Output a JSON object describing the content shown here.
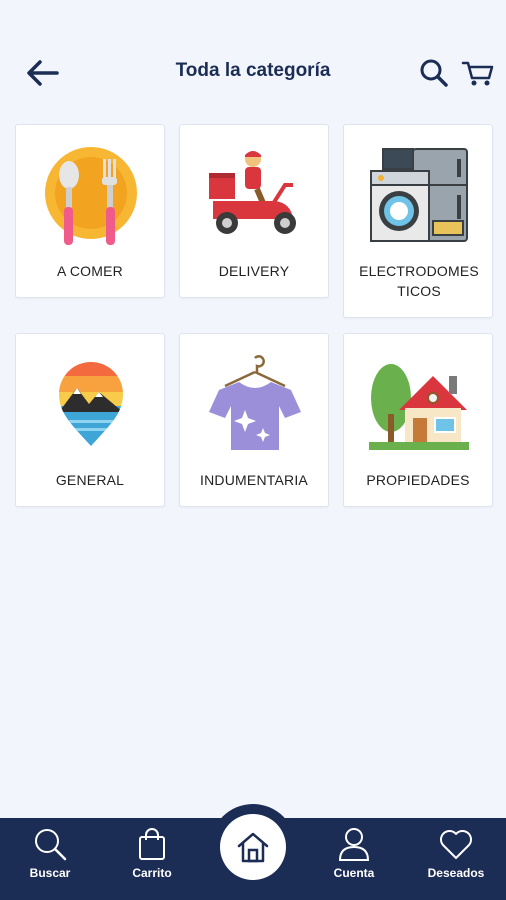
{
  "header": {
    "title": "Toda la categoría"
  },
  "categories": [
    {
      "label": "A COMER",
      "icon": "plate-cutlery-icon"
    },
    {
      "label": "DELIVERY",
      "icon": "delivery-scooter-icon"
    },
    {
      "label": "ELECTRODOMES TICOS",
      "icon": "appliances-icon"
    },
    {
      "label": "GENERAL",
      "icon": "map-pin-landscape-icon"
    },
    {
      "label": "INDUMENTARIA",
      "icon": "tshirt-hanger-icon"
    },
    {
      "label": "PROPIEDADES",
      "icon": "house-tree-icon"
    }
  ],
  "bottom_nav": {
    "search_label": "Buscar",
    "cart_label": "Carrito",
    "account_label": "Cuenta",
    "wishlist_label": "Deseados"
  },
  "colors": {
    "primary": "#1c2d55",
    "background": "#f2f6fc",
    "card": "#ffffff"
  }
}
